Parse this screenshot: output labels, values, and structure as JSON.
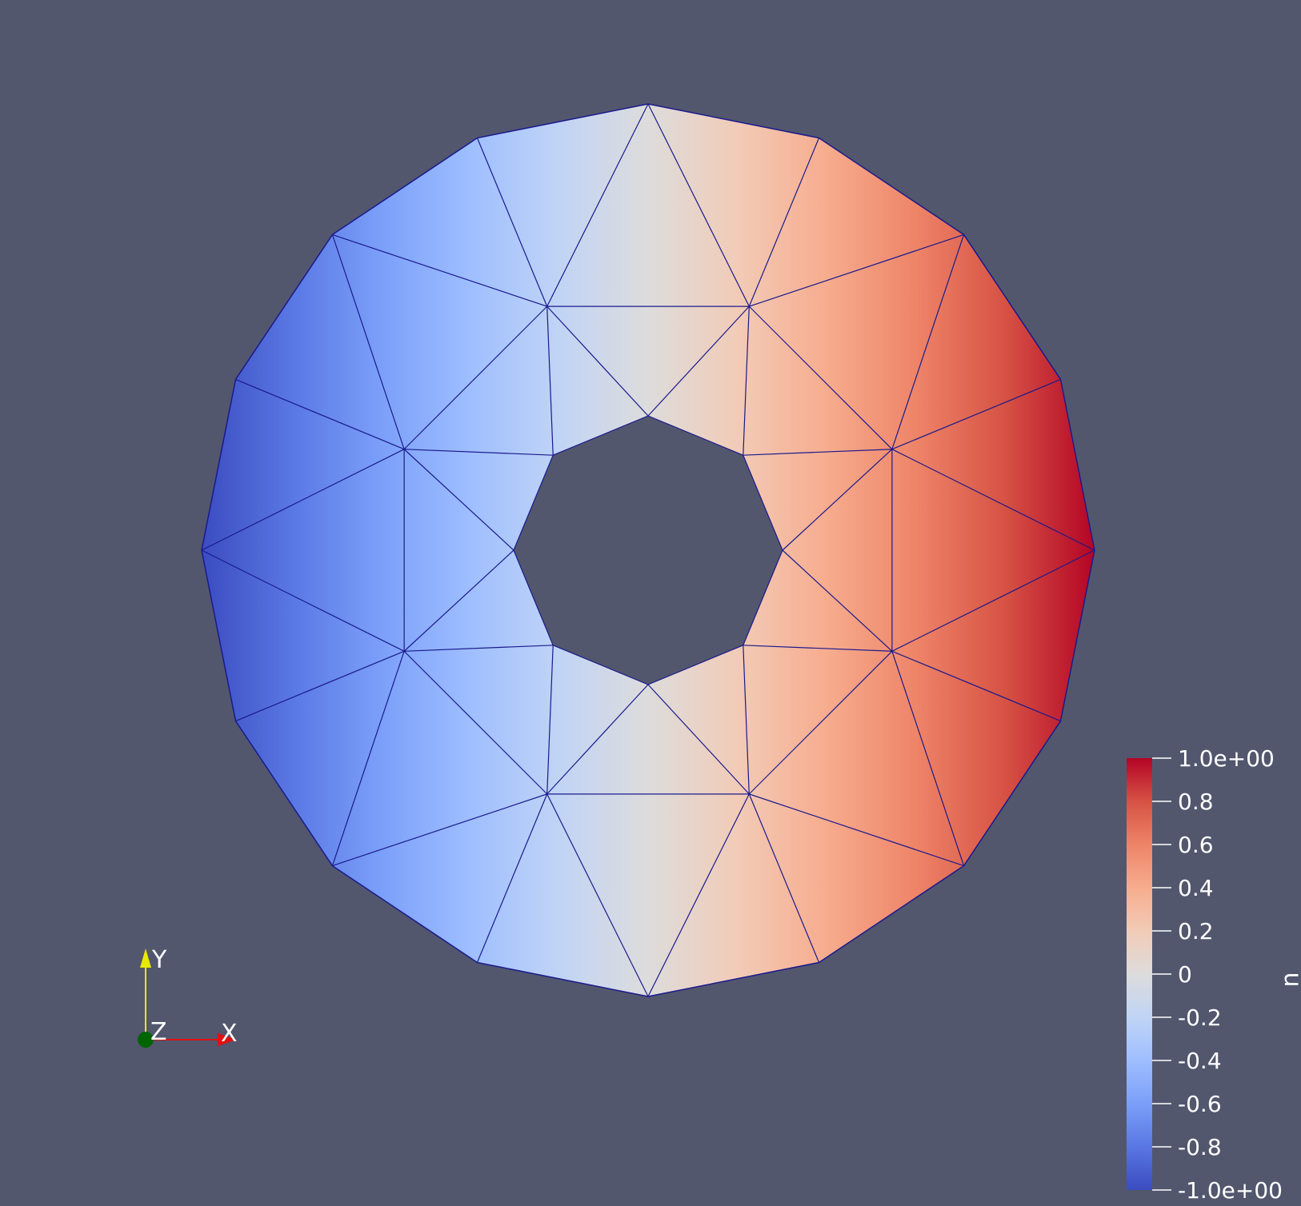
{
  "scene": {
    "background": "#52576e",
    "mesh_edge_color": "#1a1a8c",
    "mesh_description_shape": "annulus"
  },
  "colorbar": {
    "title": "u",
    "colors": [
      "#3b4cc0",
      "#5977e3",
      "#7b9ff9",
      "#9ebeff",
      "#c0d4f5",
      "#dddcdc",
      "#f2cbb7",
      "#f7ac8e",
      "#ee8468",
      "#d65244",
      "#b40426"
    ],
    "range": [
      -1.0,
      1.0
    ],
    "ticks": [
      {
        "value": 1.0,
        "label": "1.0e+00"
      },
      {
        "value": 0.8,
        "label": "0.8"
      },
      {
        "value": 0.6,
        "label": "0.6"
      },
      {
        "value": 0.4,
        "label": "0.4"
      },
      {
        "value": 0.2,
        "label": "0.2"
      },
      {
        "value": 0.0,
        "label": "0"
      },
      {
        "value": -0.2,
        "label": "-0.2"
      },
      {
        "value": -0.4,
        "label": "-0.4"
      },
      {
        "value": -0.6,
        "label": "-0.6"
      },
      {
        "value": -0.8,
        "label": "-0.8"
      },
      {
        "value": -1.0,
        "label": "-1.0e+00"
      }
    ]
  },
  "orientation_axes": {
    "x_label": "X",
    "y_label": "Y",
    "z_label": "Z",
    "x_color": "#e01010",
    "y_color": "#e8e800",
    "z_color": "#006400"
  }
}
